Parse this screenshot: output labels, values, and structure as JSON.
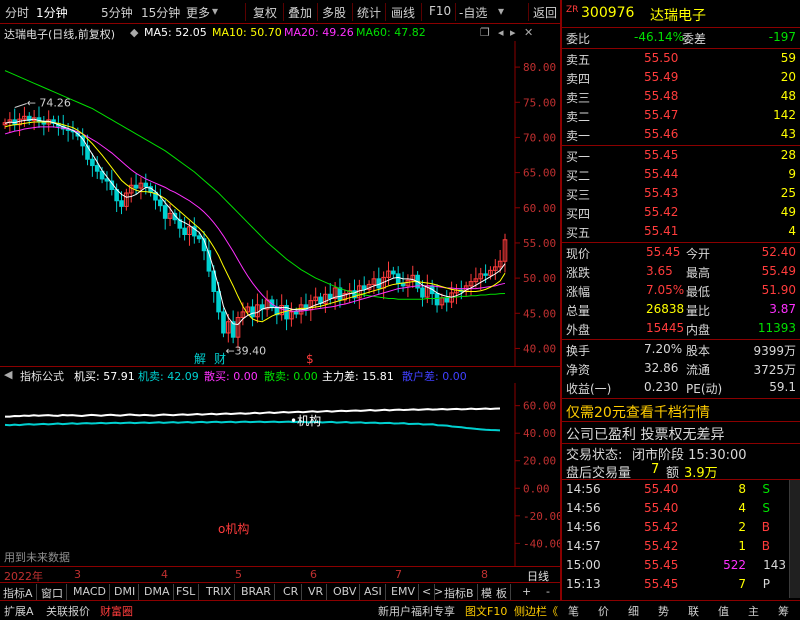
{
  "toolbar": {
    "items": [
      "分时",
      "1分钟",
      "5分钟",
      "15分钟",
      "更多",
      "复权",
      "叠加",
      "多股",
      "统计",
      "画线",
      "F10",
      "-自选",
      "返回"
    ]
  },
  "chart_title": {
    "name": "达瑞电子(日线,前复权)",
    "ma5": "MA5: 52.05",
    "ma10": "MA10: 50.70",
    "ma20": "MA20: 49.26",
    "ma60": "MA60: 47.82"
  },
  "colors": {
    "ma5": "#ffffff",
    "ma10": "#ffff00",
    "ma20": "#ff30ff",
    "ma60": "#00e000",
    "up": "#ff3c3c",
    "down": "#00d0d0",
    "grid": "#8b0000"
  },
  "annotations": {
    "high_label": "74.26",
    "low_label": "39.40",
    "marker1": "解",
    "marker2": "财",
    "marker3": "$",
    "jigou_top": "机构",
    "jigou_bottom": "机构",
    "future_data": "用到未来数据"
  },
  "indicator": {
    "name": "指标公式",
    "jimai": "机买: 57.91",
    "jimai2": "机卖: 42.09",
    "sanmai": "散买: 0.00",
    "sanmai2": "散卖: 0.00",
    "zhuli": "主力差: 15.81",
    "sanhu": "散户差: 0.00"
  },
  "date_axis": {
    "year": "2022年",
    "months": [
      "3",
      "4",
      "5",
      "6",
      "7",
      "8"
    ],
    "right": "日线"
  },
  "indicator_tabs": [
    "指标A",
    "窗口",
    "MACD",
    "DMI",
    "DMA",
    "FSL",
    "TRIX",
    "BRAR",
    "CR",
    "VR",
    "OBV",
    "ASI",
    "EMV",
    "<",
    ">",
    "指标B",
    "模",
    "板",
    "+",
    "-"
  ],
  "bottom_bar": {
    "items": [
      "扩展A",
      "关联报价",
      "财富圈"
    ],
    "right_items": [
      "新用户福利专享",
      "图文F10",
      "侧边栏《"
    ],
    "panel_tabs": [
      "笔",
      "价",
      "细",
      "势",
      "联",
      "值",
      "主",
      "筹"
    ]
  },
  "chart_data": {
    "type": "candlestick",
    "y_ticks_main": [
      "80.00",
      "75.00",
      "70.00",
      "65.00",
      "60.00",
      "55.00",
      "50.00",
      "45.00",
      "40.00"
    ],
    "ylim_main": [
      38.5,
      83.0
    ],
    "y_ticks_ind": [
      "60.00",
      "40.00",
      "20.00",
      "0.00",
      "-20.00",
      "-40.00"
    ],
    "ylim_ind": [
      -55,
      75
    ],
    "x_labels": [
      "2022年",
      "3",
      "4",
      "5",
      "6",
      "7",
      "8"
    ],
    "high_annotation": 74.26,
    "low_annotation": 39.4,
    "close_series": [
      72.1,
      72.5,
      71.8,
      72.6,
      73.0,
      72.4,
      72.8,
      72.2,
      71.9,
      72.5,
      72.0,
      71.6,
      71.2,
      71.0,
      70.8,
      70.2,
      68.8,
      66.9,
      66.0,
      65.2,
      64.1,
      63.8,
      62.6,
      61.0,
      60.2,
      62.1,
      63.2,
      62.8,
      63.5,
      63.0,
      62.2,
      61.1,
      60.3,
      58.5,
      59.2,
      58.3,
      57.1,
      56.2,
      57.3,
      56.0,
      55.6,
      53.9,
      51.0,
      48.1,
      45.2,
      42.2,
      43.8,
      41.6,
      44.4,
      45.2,
      45.9,
      44.5,
      46.2,
      45.6,
      46.9,
      45.9,
      44.8,
      46.1,
      44.2,
      45.2,
      44.9,
      46.2,
      45.5,
      46.8,
      47.3,
      46.4,
      47.7,
      47.1,
      48.6,
      46.9,
      47.8,
      48.2,
      47.2,
      48.9,
      48.4,
      49.1,
      49.9,
      48.6,
      50.1,
      51.0,
      50.6,
      49.3,
      48.9,
      49.7,
      50.4,
      48.6,
      47.3,
      48.9,
      47.8,
      46.2,
      47.2,
      46.6,
      47.9,
      48.3,
      48.1,
      48.9,
      49.5,
      49.9,
      50.6,
      50.4,
      51.1,
      51.6,
      52.4,
      55.45
    ],
    "ma5": [
      72.0,
      72.2,
      72.1,
      72.3,
      72.4,
      72.5,
      72.6,
      72.4,
      72.3,
      72.3,
      72.1,
      71.8,
      71.5,
      71.3,
      71.0,
      70.5,
      69.8,
      68.7,
      67.6,
      66.5,
      65.3,
      64.4,
      63.5,
      62.6,
      61.9,
      61.5,
      61.6,
      61.9,
      62.4,
      62.9,
      62.8,
      62.3,
      61.6,
      60.7,
      59.9,
      58.9,
      58.2,
      57.9,
      57.5,
      57.0,
      56.5,
      55.4,
      53.5,
      51.3,
      48.8,
      46.0,
      44.4,
      43.5,
      43.4,
      44.2,
      44.7,
      45.0,
      45.1,
      45.6,
      45.8,
      45.8,
      45.8,
      45.8,
      45.8,
      45.6,
      45.5,
      45.5,
      45.6,
      45.9,
      46.2,
      46.4,
      46.7,
      47.0,
      47.3,
      47.4,
      47.6,
      47.8,
      47.9,
      48.2,
      48.3,
      48.6,
      48.9,
      49.1,
      49.4,
      49.7,
      50.0,
      50.1,
      49.9,
      49.9,
      49.8,
      49.5,
      49.0,
      48.7,
      48.4,
      47.9,
      47.6,
      47.4,
      47.3,
      47.5,
      47.8,
      48.3,
      48.6,
      49.0,
      49.4,
      49.8,
      50.2,
      50.6,
      51.1,
      52.05
    ],
    "ma10": [
      71.5,
      71.7,
      71.8,
      71.9,
      72.0,
      72.1,
      72.2,
      72.2,
      72.2,
      72.2,
      72.1,
      72.0,
      71.8,
      71.6,
      71.4,
      71.0,
      70.5,
      69.8,
      69.1,
      68.3,
      67.5,
      66.6,
      65.7,
      64.8,
      63.9,
      63.3,
      62.8,
      62.5,
      62.3,
      62.3,
      62.2,
      62.0,
      61.7,
      61.3,
      60.7,
      60.1,
      59.5,
      58.9,
      58.3,
      57.7,
      57.1,
      56.4,
      55.5,
      54.4,
      53.2,
      51.7,
      50.3,
      48.9,
      47.4,
      46.0,
      44.9,
      44.2,
      43.9,
      43.8,
      44.2,
      44.6,
      44.9,
      45.1,
      45.3,
      45.5,
      45.6,
      45.7,
      45.7,
      45.8,
      45.9,
      46.0,
      46.2,
      46.4,
      46.6,
      46.8,
      47.0,
      47.2,
      47.4,
      47.6,
      47.8,
      48.0,
      48.2,
      48.4,
      48.6,
      48.9,
      49.1,
      49.2,
      49.3,
      49.4,
      49.5,
      49.5,
      49.4,
      49.3,
      49.2,
      49.0,
      48.8,
      48.6,
      48.4,
      48.3,
      48.2,
      48.1,
      48.1,
      48.1,
      48.2,
      48.4,
      48.7,
      49.1,
      49.6,
      50.7
    ],
    "ma20": [
      70.5,
      70.7,
      70.9,
      71.0,
      71.2,
      71.3,
      71.4,
      71.5,
      71.5,
      71.5,
      71.5,
      71.4,
      71.3,
      71.2,
      71.0,
      70.8,
      70.5,
      70.1,
      69.7,
      69.3,
      68.8,
      68.3,
      67.8,
      67.2,
      66.6,
      66.0,
      65.4,
      64.9,
      64.5,
      64.1,
      63.8,
      63.5,
      63.2,
      62.9,
      62.5,
      62.2,
      61.8,
      61.4,
      61.0,
      60.5,
      60.0,
      59.4,
      58.7,
      57.9,
      57.0,
      56.0,
      54.9,
      53.8,
      52.6,
      51.4,
      50.3,
      49.3,
      48.4,
      47.6,
      46.9,
      46.3,
      45.9,
      45.6,
      45.4,
      45.3,
      45.3,
      45.3,
      45.4,
      45.5,
      45.6,
      45.7,
      45.8,
      45.9,
      46.0,
      46.2,
      46.3,
      46.5,
      46.7,
      46.9,
      47.1,
      47.3,
      47.5,
      47.7,
      47.9,
      48.1,
      48.3,
      48.5,
      48.6,
      48.7,
      48.8,
      48.9,
      48.9,
      48.9,
      48.9,
      48.8,
      48.7,
      48.6,
      48.6,
      48.5,
      48.5,
      48.5,
      48.5,
      48.5,
      48.6,
      48.7,
      48.8,
      48.9,
      49.1,
      49.26
    ],
    "ma60": [
      79.5,
      79.2,
      78.9,
      78.6,
      78.3,
      78.0,
      77.7,
      77.4,
      77.1,
      76.8,
      76.5,
      76.2,
      75.9,
      75.6,
      75.3,
      75.0,
      74.7,
      74.4,
      74.1,
      73.7,
      73.3,
      72.9,
      72.5,
      72.1,
      71.7,
      71.3,
      70.9,
      70.5,
      70.1,
      69.7,
      69.3,
      68.9,
      68.5,
      68.1,
      67.6,
      67.1,
      66.6,
      66.1,
      65.6,
      65.1,
      64.5,
      63.9,
      63.3,
      62.7,
      62.1,
      61.4,
      60.7,
      60.0,
      59.3,
      58.6,
      57.9,
      57.2,
      56.5,
      55.8,
      55.1,
      54.5,
      53.9,
      53.3,
      52.7,
      52.2,
      51.7,
      51.2,
      50.8,
      50.4,
      50.0,
      49.7,
      49.4,
      49.1,
      48.8,
      48.5,
      48.3,
      48.1,
      47.9,
      47.7,
      47.6,
      47.5,
      47.4,
      47.3,
      47.2,
      47.1,
      47.1,
      47.0,
      47.0,
      47.0,
      47.0,
      47.0,
      47.0,
      47.1,
      47.1,
      47.1,
      47.2,
      47.2,
      47.3,
      47.3,
      47.4,
      47.4,
      47.5,
      47.5,
      47.6,
      47.6,
      47.7,
      47.7,
      47.8,
      47.82
    ],
    "ind_white": [
      52,
      52,
      52.5,
      52.4,
      52.8,
      52.6,
      53,
      52.7,
      52.9,
      53.1,
      52.8,
      52.6,
      53.2,
      52.9,
      53.1,
      52.8,
      52.5,
      52.9,
      53.3,
      53.0,
      52.7,
      53.1,
      53.4,
      53.0,
      52.8,
      53.2,
      53.6,
      53.2,
      52.9,
      53.3,
      53.0,
      52.8,
      53.2,
      53.6,
      53.3,
      53.0,
      53.4,
      53.7,
      53.3,
      53.6,
      53.9,
      53.5,
      53.8,
      54.1,
      53.7,
      54.0,
      54.3,
      53.9,
      54.2,
      54.5,
      54.1,
      54.4,
      54.8,
      54.4,
      54.8,
      55.1,
      54.7,
      55.0,
      55.4,
      55.0,
      55.3,
      55.6,
      55.2,
      55.6,
      55.9,
      55.5,
      55.8,
      56.1,
      55.7,
      56.0,
      56.3,
      56.0,
      56.3,
      56.5,
      56.2,
      56.5,
      56.8,
      56.4,
      56.7,
      57.0,
      56.6,
      56.9,
      57.1,
      56.8,
      57.0,
      57.3,
      56.9,
      57.2,
      57.5,
      57.1,
      57.3,
      57.6,
      57.2,
      57.5,
      57.7,
      57.3,
      57.5,
      57.8,
      57.5,
      57.7,
      57.9,
      57.6,
      57.8,
      57.91
    ],
    "ind_cyan": [
      46,
      45.8,
      46.2,
      45.9,
      46.3,
      46.6,
      46.2,
      46.5,
      46.8,
      46.4,
      46.7,
      47.0,
      46.6,
      46.9,
      47.2,
      46.8,
      47.1,
      47.3,
      47.0,
      47.2,
      47.5,
      47.1,
      47.4,
      47.6,
      47.2,
      47.5,
      47.7,
      47.3,
      47.6,
      47.8,
      47.4,
      47.7,
      47.9,
      47.5,
      47.8,
      48.0,
      47.6,
      47.9,
      48.1,
      47.7,
      48.0,
      48.2,
      47.8,
      48.1,
      48.3,
      47.9,
      48.1,
      48.3,
      47.9,
      48.2,
      48.4,
      48.0,
      48.2,
      48.4,
      48.0,
      48.2,
      48.4,
      48.0,
      48.2,
      48.4,
      48.0,
      48.2,
      48.3,
      47.9,
      48.1,
      48.3,
      47.8,
      48.0,
      48.2,
      47.7,
      47.9,
      48.1,
      47.6,
      47.8,
      47.9,
      47.4,
      47.6,
      47.7,
      47.2,
      47.4,
      47.5,
      47.0,
      47.1,
      47.3,
      46.7,
      46.8,
      46.9,
      46.3,
      46.4,
      46.5,
      45.8,
      45.7,
      45.5,
      44.9,
      44.6,
      44.3,
      43.8,
      43.5,
      43.1,
      42.8,
      42.5,
      42.3,
      42.2,
      42.09
    ]
  },
  "quote": {
    "code": "300976",
    "name": "达瑞电子",
    "zr_tag": "ZR",
    "weibi_label": "委比",
    "weibi": "-46.14%",
    "weicha_label": "委差",
    "weicha": "-197",
    "asks": [
      {
        "label": "卖五",
        "price": "55.50",
        "vol": "59"
      },
      {
        "label": "卖四",
        "price": "55.49",
        "vol": "20"
      },
      {
        "label": "卖三",
        "price": "55.48",
        "vol": "48"
      },
      {
        "label": "卖二",
        "price": "55.47",
        "vol": "142"
      },
      {
        "label": "卖一",
        "price": "55.46",
        "vol": "43"
      }
    ],
    "bids": [
      {
        "label": "买一",
        "price": "55.45",
        "vol": "28"
      },
      {
        "label": "买二",
        "price": "55.44",
        "vol": "9"
      },
      {
        "label": "买三",
        "price": "55.43",
        "vol": "25"
      },
      {
        "label": "买四",
        "price": "55.42",
        "vol": "49"
      },
      {
        "label": "买五",
        "price": "55.41",
        "vol": "4"
      }
    ],
    "stats": [
      {
        "l1": "现价",
        "v1": "55.45",
        "l2": "今开",
        "v2": "52.40"
      },
      {
        "l1": "涨跌",
        "v1": "3.65",
        "l2": "最高",
        "v2": "55.49"
      },
      {
        "l1": "涨幅",
        "v1": "7.05%",
        "l2": "最低",
        "v2": "51.90"
      },
      {
        "l1": "总量",
        "v1": "26838",
        "l2": "量比",
        "v2": "3.87"
      },
      {
        "l1": "外盘",
        "v1": "15445",
        "l2": "内盘",
        "v2": "11393"
      }
    ],
    "stats2": [
      {
        "l1": "换手",
        "v1": "7.20%",
        "l2": "股本",
        "v2": "9399万"
      },
      {
        "l1": "净资",
        "v1": "32.86",
        "l2": "流通",
        "v2": "3725万"
      },
      {
        "l1": "收益(一)",
        "v1": "0.230",
        "l2": "PE(动)",
        "v2": "59.1"
      }
    ],
    "promo": "仅需20元查看千档行情",
    "profit_note": "公司已盈利 投票权无差异",
    "trade_status_label": "交易状态:",
    "trade_status": "闭市阶段 15:30:00",
    "after_hours_label": "盘后交易量",
    "after_hours_vol": "7",
    "after_hours_amt_label": "额",
    "after_hours_amt": "3.9万",
    "ticks": [
      {
        "time": "14:56",
        "price": "55.40",
        "vol": "8",
        "bs": "S"
      },
      {
        "time": "14:56",
        "price": "55.40",
        "vol": "4",
        "bs": "S"
      },
      {
        "time": "14:56",
        "price": "55.42",
        "vol": "2",
        "bs": "B"
      },
      {
        "time": "14:57",
        "price": "55.42",
        "vol": "1",
        "bs": "B"
      },
      {
        "time": "15:00",
        "price": "55.45",
        "vol": "522",
        "bs": "143"
      },
      {
        "time": "15:13",
        "price": "55.45",
        "vol": "7",
        "bs": "P"
      }
    ]
  }
}
